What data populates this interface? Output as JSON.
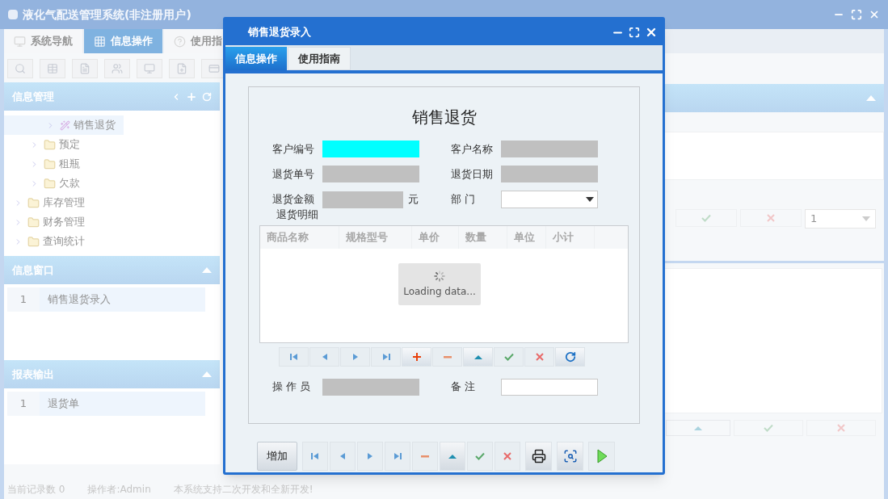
{
  "app": {
    "title": "液化气配送管理系统(非注册用户)",
    "tabs": [
      {
        "label": "系统导航",
        "selected": false,
        "kind": "nav"
      },
      {
        "label": "信息操作",
        "selected": true,
        "kind": "grid"
      },
      {
        "label": "使用指",
        "selected": false,
        "kind": "help"
      }
    ]
  },
  "sidebar": {
    "tree_panel": {
      "title": "信息管理",
      "tree": [
        {
          "children": [
            {
              "children": [
                {
                  "label": "销售退货",
                  "kind": "leaf",
                  "selected": true
                }
              ]
            },
            {
              "label": "预定",
              "kind": "folder",
              "selected": false
            },
            {
              "label": "租瓶",
              "kind": "folder",
              "selected": false
            },
            {
              "label": "欠款",
              "kind": "folder",
              "selected": false
            }
          ]
        },
        {
          "label": "库存管理",
          "kind": "folder",
          "selected": false
        },
        {
          "label": "财务管理",
          "kind": "folder",
          "selected": false
        },
        {
          "label": "查询统计",
          "kind": "folder",
          "selected": false
        }
      ]
    },
    "lists": [
      {
        "title": "信息窗口",
        "rows": [
          {
            "index": "1",
            "label": "销售退货录入"
          }
        ]
      },
      {
        "title": "报表输出",
        "rows": [
          {
            "index": "1",
            "label": "退货单"
          }
        ]
      }
    ]
  },
  "background_pager": {
    "page_select": "1"
  },
  "status_bar": [
    "当前记录数 0",
    "操作者:Admin",
    "本系统支持二次开发和全新开发!"
  ],
  "dialog": {
    "title": "销售退货录入",
    "tabs": [
      {
        "label": "信息操作",
        "selected": true
      },
      {
        "label": "使用指南",
        "selected": false
      }
    ],
    "form_title": "销售退货",
    "fields": [
      {
        "label": "客户编号",
        "kind": "text",
        "highlighted": true,
        "disabled": false
      },
      {
        "label": "客户名称",
        "kind": "text",
        "highlighted": false,
        "disabled": true
      },
      {
        "label": "退货单号",
        "kind": "text",
        "highlighted": false,
        "disabled": true
      },
      {
        "label": "退货日期",
        "kind": "text",
        "highlighted": false,
        "disabled": true
      },
      {
        "label": "退货金额",
        "kind": "text",
        "highlighted": false,
        "disabled": true,
        "unit": "元"
      },
      {
        "label": "部 门",
        "kind": "select",
        "highlighted": false,
        "disabled": false
      }
    ],
    "detail_label": "退货明细",
    "grid": {
      "columns": [
        "商品名称",
        "规格型号",
        "单价",
        "数量",
        "单位",
        "小计"
      ],
      "loading": "Loading data..."
    },
    "grid_buttons": [
      {
        "kind": "first"
      },
      {
        "kind": "prev"
      },
      {
        "kind": "next"
      },
      {
        "kind": "last"
      },
      {
        "kind": "add"
      },
      {
        "kind": "remove"
      },
      {
        "kind": "up"
      },
      {
        "kind": "save"
      },
      {
        "kind": "cancel"
      },
      {
        "kind": "refresh"
      }
    ],
    "footer_fields": [
      {
        "label": "操 作 员",
        "kind": "text",
        "highlighted": false,
        "disabled": true
      },
      {
        "label": "备 注",
        "kind": "text",
        "highlighted": false,
        "disabled": false
      }
    ],
    "toolbar": [
      {
        "kind": "text",
        "label": "增加"
      },
      {
        "kind": "first"
      },
      {
        "kind": "prev"
      },
      {
        "kind": "next"
      },
      {
        "kind": "last"
      },
      {
        "kind": "remove"
      },
      {
        "kind": "up"
      },
      {
        "kind": "save"
      },
      {
        "kind": "cancel"
      },
      {
        "kind": "print"
      },
      {
        "kind": "preview"
      },
      {
        "kind": "run"
      }
    ]
  }
}
